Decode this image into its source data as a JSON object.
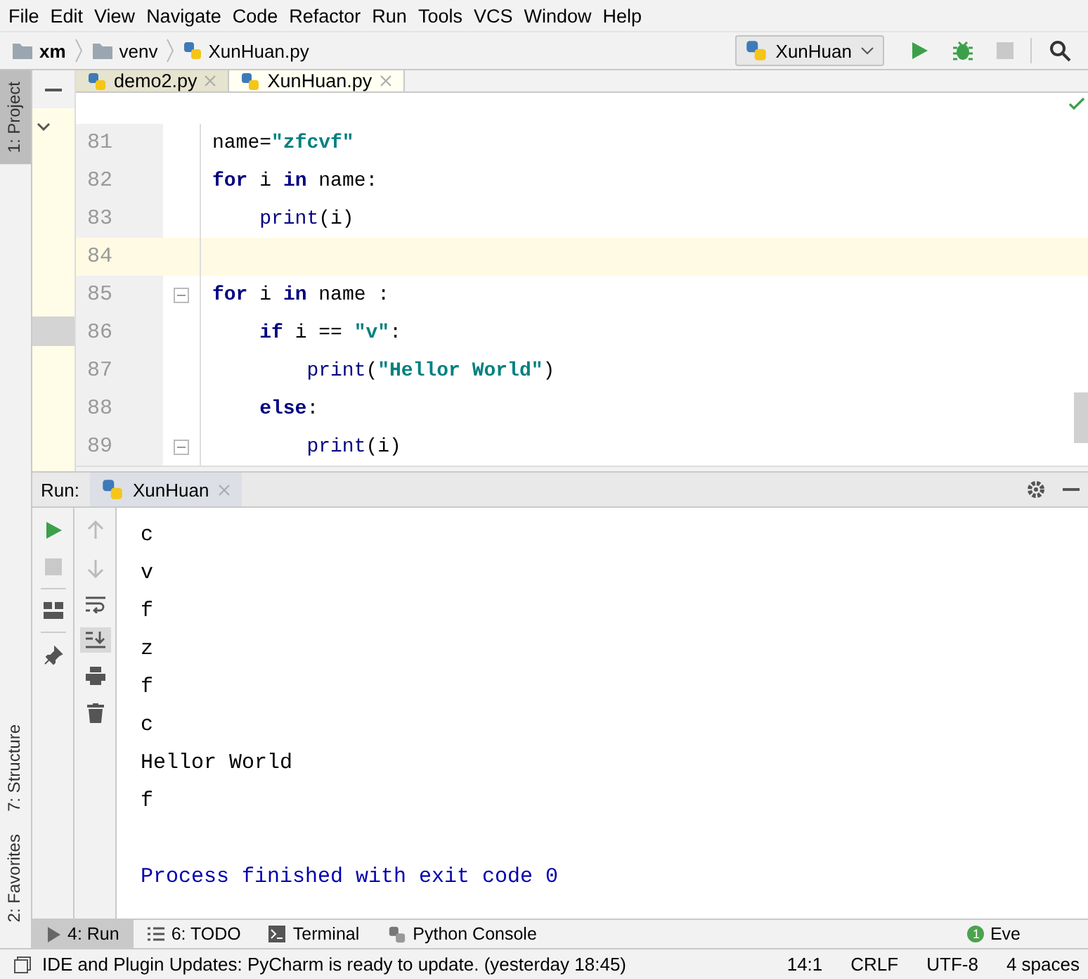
{
  "menu": [
    "File",
    "Edit",
    "View",
    "Navigate",
    "Code",
    "Refactor",
    "Run",
    "Tools",
    "VCS",
    "Window",
    "Help"
  ],
  "breadcrumbs": [
    {
      "label": "xm",
      "kind": "root"
    },
    {
      "label": "venv",
      "kind": "folder"
    },
    {
      "label": "XunHuan.py",
      "kind": "file"
    }
  ],
  "run_config": {
    "label": "XunHuan"
  },
  "left_tools_top": [
    {
      "label": "1: Project",
      "selected": true
    }
  ],
  "left_tools_bottom": [
    {
      "label": "7: Structure",
      "selected": false
    },
    {
      "label": "2: Favorites",
      "selected": false
    }
  ],
  "editor_tabs": [
    {
      "label": "demo2.py",
      "selected": false
    },
    {
      "label": "XunHuan.py",
      "selected": true
    }
  ],
  "code_lines": [
    {
      "number": "81",
      "current": false,
      "fold": false,
      "tokens": [
        {
          "text": "name=",
          "kind": "plain"
        },
        {
          "text": "\"zfcvf\"",
          "kind": "string"
        }
      ]
    },
    {
      "number": "82",
      "current": false,
      "fold": false,
      "tokens": [
        {
          "text": "for",
          "kind": "keyword"
        },
        {
          "text": " i ",
          "kind": "plain"
        },
        {
          "text": "in",
          "kind": "keyword"
        },
        {
          "text": " name:",
          "kind": "plain"
        }
      ]
    },
    {
      "number": "83",
      "current": false,
      "fold": false,
      "tokens": [
        {
          "text": "    print",
          "kind": "builtin"
        },
        {
          "text": "(i)",
          "kind": "plain"
        }
      ]
    },
    {
      "number": "84",
      "current": true,
      "fold": false
    },
    {
      "number": "85",
      "current": false,
      "fold": true,
      "tokens": [
        {
          "text": "for",
          "kind": "keyword"
        },
        {
          "text": " i ",
          "kind": "plain"
        },
        {
          "text": "in",
          "kind": "keyword"
        },
        {
          "text": " name :",
          "kind": "plain"
        }
      ]
    },
    {
      "number": "86",
      "current": false,
      "fold": false,
      "tokens": [
        {
          "text": "    if",
          "kind": "keyword"
        },
        {
          "text": " i == ",
          "kind": "plain"
        },
        {
          "text": "\"v\"",
          "kind": "string"
        },
        {
          "text": ":",
          "kind": "plain"
        }
      ]
    },
    {
      "number": "87",
      "current": false,
      "fold": false,
      "tokens": [
        {
          "text": "        print",
          "kind": "builtin"
        },
        {
          "text": "(",
          "kind": "plain"
        },
        {
          "text": "\"Hellor World\"",
          "kind": "string"
        },
        {
          "text": ")",
          "kind": "plain"
        }
      ]
    },
    {
      "number": "88",
      "current": false,
      "fold": false,
      "tokens": [
        {
          "text": "    else",
          "kind": "keyword"
        },
        {
          "text": ":",
          "kind": "plain"
        }
      ]
    },
    {
      "number": "89",
      "current": false,
      "fold": true,
      "tokens": [
        {
          "text": "        print",
          "kind": "builtin"
        },
        {
          "text": "(i)",
          "kind": "plain"
        }
      ]
    }
  ],
  "run_panel": {
    "label": "Run:",
    "tab": "XunHuan",
    "output": [
      {
        "text": "c",
        "kind": "stdout"
      },
      {
        "text": "v",
        "kind": "stdout"
      },
      {
        "text": "f",
        "kind": "stdout"
      },
      {
        "text": "z",
        "kind": "stdout"
      },
      {
        "text": "f",
        "kind": "stdout"
      },
      {
        "text": "c",
        "kind": "stdout"
      },
      {
        "text": "Hellor World",
        "kind": "stdout"
      },
      {
        "text": "f",
        "kind": "stdout"
      },
      {
        "text": "Process finished with exit code 0",
        "kind": "system"
      }
    ]
  },
  "bottom_tabs": [
    {
      "label": "4: Run",
      "kind": "run",
      "selected": true
    },
    {
      "label": "6: TODO",
      "kind": "todo",
      "selected": false
    },
    {
      "label": "Terminal",
      "kind": "terminal",
      "selected": false
    },
    {
      "label": "Python Console",
      "kind": "console",
      "selected": false
    }
  ],
  "event_log": {
    "count": "1",
    "label": "Eve"
  },
  "status_bar": {
    "message": "IDE and Plugin Updates: PyCharm is ready to update. (yesterday 18:45)",
    "items": [
      "14:1",
      "CRLF",
      "UTF-8",
      "4 spaces"
    ]
  }
}
